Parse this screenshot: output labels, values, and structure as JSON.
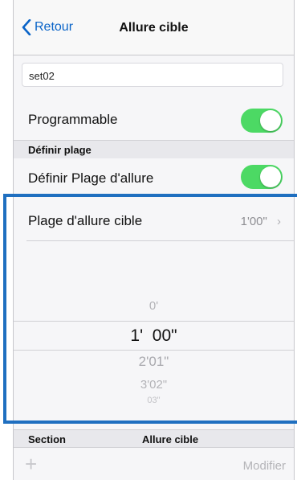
{
  "navbar": {
    "back_label": "Retour",
    "title": "Allure cible"
  },
  "name_field": {
    "value": "set02"
  },
  "programmable": {
    "label": "Programmable",
    "enabled": true
  },
  "section_define": {
    "label": "Définir plage"
  },
  "define_range": {
    "label": "Définir Plage d'allure",
    "enabled": true
  },
  "target_range": {
    "label": "Plage d'allure cible",
    "value": "1'00\""
  },
  "picker": {
    "item_above": "0'",
    "selected": "1'  00\"",
    "item_below_1": "2'01\"",
    "item_below_2": "3'02\"",
    "item_below_3": "03\""
  },
  "table_header": {
    "section": "Section",
    "target": "Allure cible"
  },
  "bottom": {
    "modify_label": "Modifier"
  },
  "colors": {
    "accent": "#0a64c8",
    "toggle_on": "#4cd964",
    "highlight": "#1f6fc0"
  }
}
